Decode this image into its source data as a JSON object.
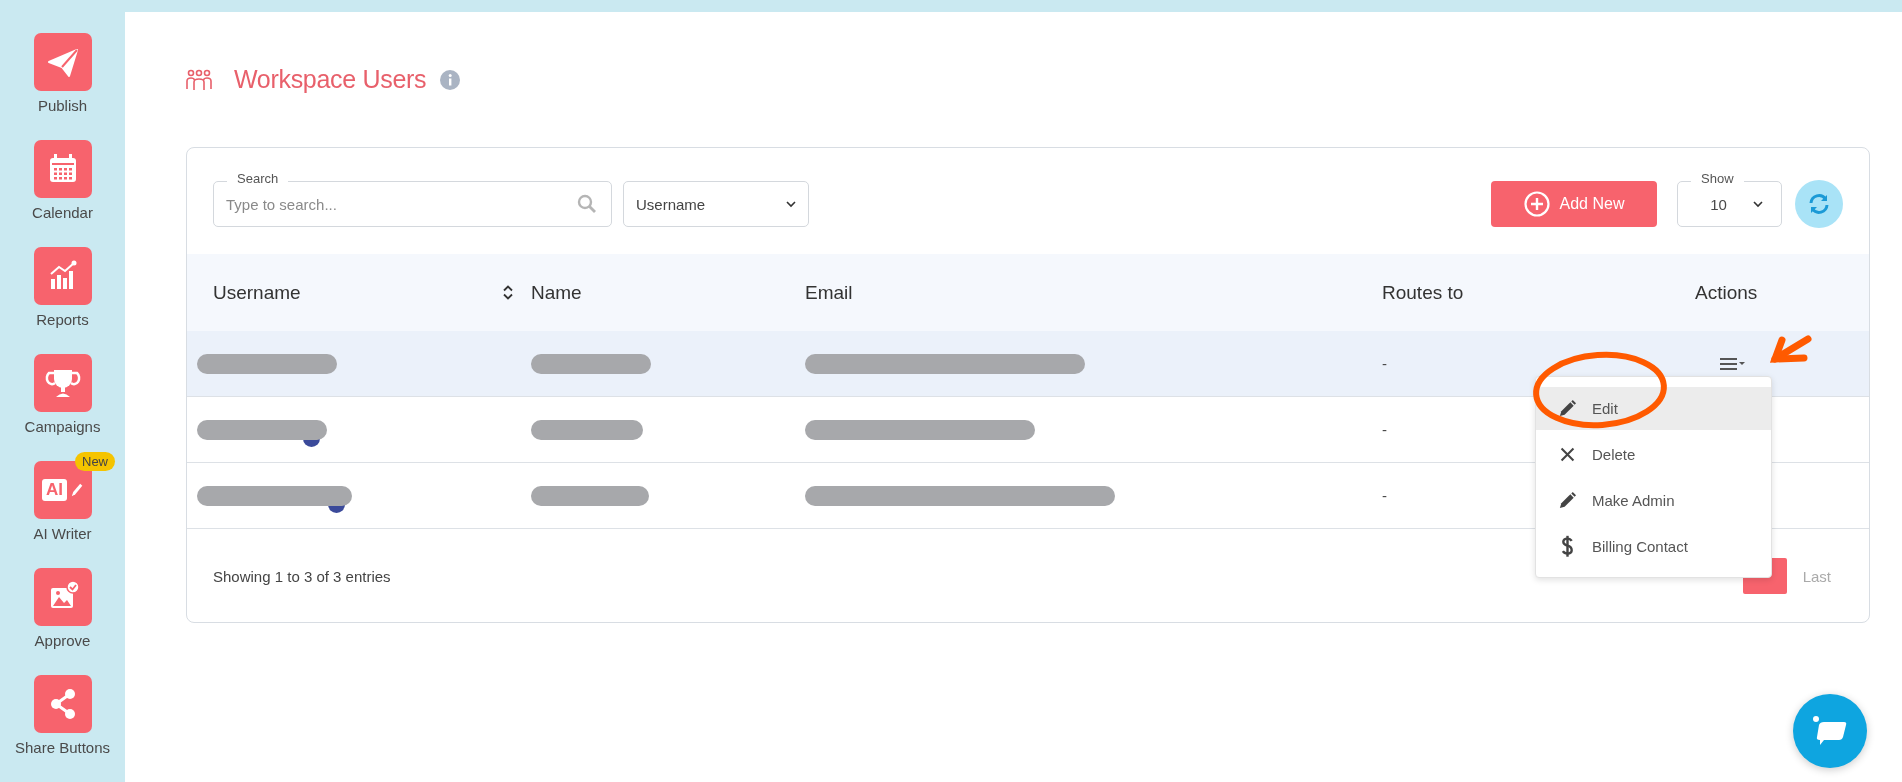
{
  "sidebar": {
    "items": [
      {
        "kind": "publish",
        "label": "Publish"
      },
      {
        "kind": "calendar",
        "label": "Calendar"
      },
      {
        "kind": "reports",
        "label": "Reports"
      },
      {
        "kind": "campaigns",
        "label": "Campaigns"
      },
      {
        "kind": "ai",
        "label": "AI Writer",
        "icon_text": "AI",
        "badge": "New"
      },
      {
        "kind": "approve",
        "label": "Approve"
      },
      {
        "kind": "share",
        "label": "Share Buttons"
      }
    ]
  },
  "page": {
    "title": "Workspace Users"
  },
  "toolbar": {
    "search": {
      "label": "Search",
      "placeholder": "Type to search..."
    },
    "filter": {
      "value": "Username"
    },
    "add_button": "Add New",
    "show": {
      "label": "Show",
      "value": "10"
    }
  },
  "table": {
    "columns": [
      {
        "label": "Username",
        "sortable": true
      },
      {
        "label": "Name",
        "sortable": false
      },
      {
        "label": "Email",
        "sortable": false
      },
      {
        "label": "Routes to",
        "sortable": false
      },
      {
        "label": "Actions",
        "sortable": false
      }
    ],
    "rows": [
      {
        "selected": true,
        "routes_to": "-",
        "user_badge": false
      },
      {
        "selected": false,
        "routes_to": "-",
        "user_badge": true
      },
      {
        "selected": false,
        "routes_to": "-",
        "user_badge": true
      }
    ]
  },
  "action_menu": {
    "items": [
      {
        "kind": "edit",
        "label": "Edit",
        "highlighted": true
      },
      {
        "kind": "delete",
        "label": "Delete",
        "highlighted": false
      },
      {
        "kind": "edit",
        "label": "Make Admin",
        "highlighted": false
      },
      {
        "kind": "billing",
        "label": "Billing Contact",
        "highlighted": false
      }
    ]
  },
  "footer": {
    "info": "Showing 1 to 3 of 3 entries",
    "pagination": [
      {
        "kind": "page",
        "selected": true
      },
      {
        "kind": "link",
        "label": "Last"
      }
    ]
  }
}
